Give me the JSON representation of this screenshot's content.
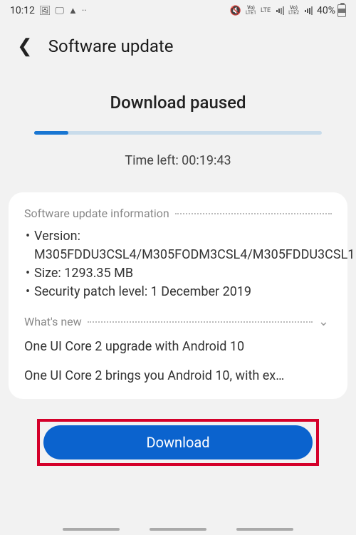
{
  "status_bar": {
    "time": "10:12",
    "battery_pct": "40%"
  },
  "header": {
    "title": "Software update"
  },
  "download": {
    "title": "Download paused",
    "progress_pct": 12,
    "time_left": "Time left: 00:19:43"
  },
  "info": {
    "section_label": "Software update information",
    "version": "Version: M305FDDU3CSL4/M305FODM3CSL4/M305FDDU3CSL1",
    "size": "Size: 1293.35 MB",
    "security": "Security patch level: 1 December 2019"
  },
  "whats_new": {
    "label": "What's new",
    "headline": "One UI Core 2 upgrade with Android 10",
    "body": "One UI Core 2 brings you Android 10, with ex…"
  },
  "button": {
    "label": "Download"
  }
}
